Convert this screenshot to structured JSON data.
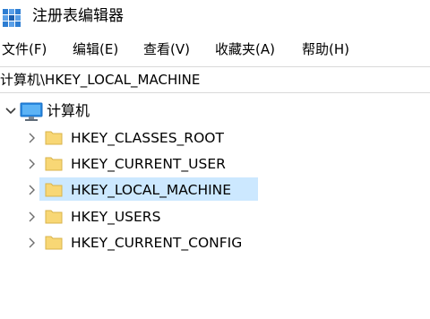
{
  "window": {
    "title": "注册表编辑器",
    "icon": "registry-editor-icon"
  },
  "menu": [
    {
      "label": "文件(F)"
    },
    {
      "label": "编辑(E)"
    },
    {
      "label": "查看(V)"
    },
    {
      "label": "收藏夹(A)"
    },
    {
      "label": "帮助(H)"
    }
  ],
  "address": {
    "path": "计算机\\HKEY_LOCAL_MACHINE"
  },
  "tree": {
    "root": {
      "label": "计算机",
      "icon": "computer-icon",
      "expanded": true
    },
    "children": [
      {
        "label": "HKEY_CLASSES_ROOT",
        "selected": false,
        "icon": "folder-icon"
      },
      {
        "label": "HKEY_CURRENT_USER",
        "selected": false,
        "icon": "folder-icon"
      },
      {
        "label": "HKEY_LOCAL_MACHINE",
        "selected": true,
        "icon": "folder-icon"
      },
      {
        "label": "HKEY_USERS",
        "selected": false,
        "icon": "folder-icon"
      },
      {
        "label": "HKEY_CURRENT_CONFIG",
        "selected": false,
        "icon": "folder-icon"
      }
    ]
  },
  "colors": {
    "selection": "#cce8ff",
    "folder": "#f8d775",
    "icon_blue": "#1a6fc4"
  }
}
